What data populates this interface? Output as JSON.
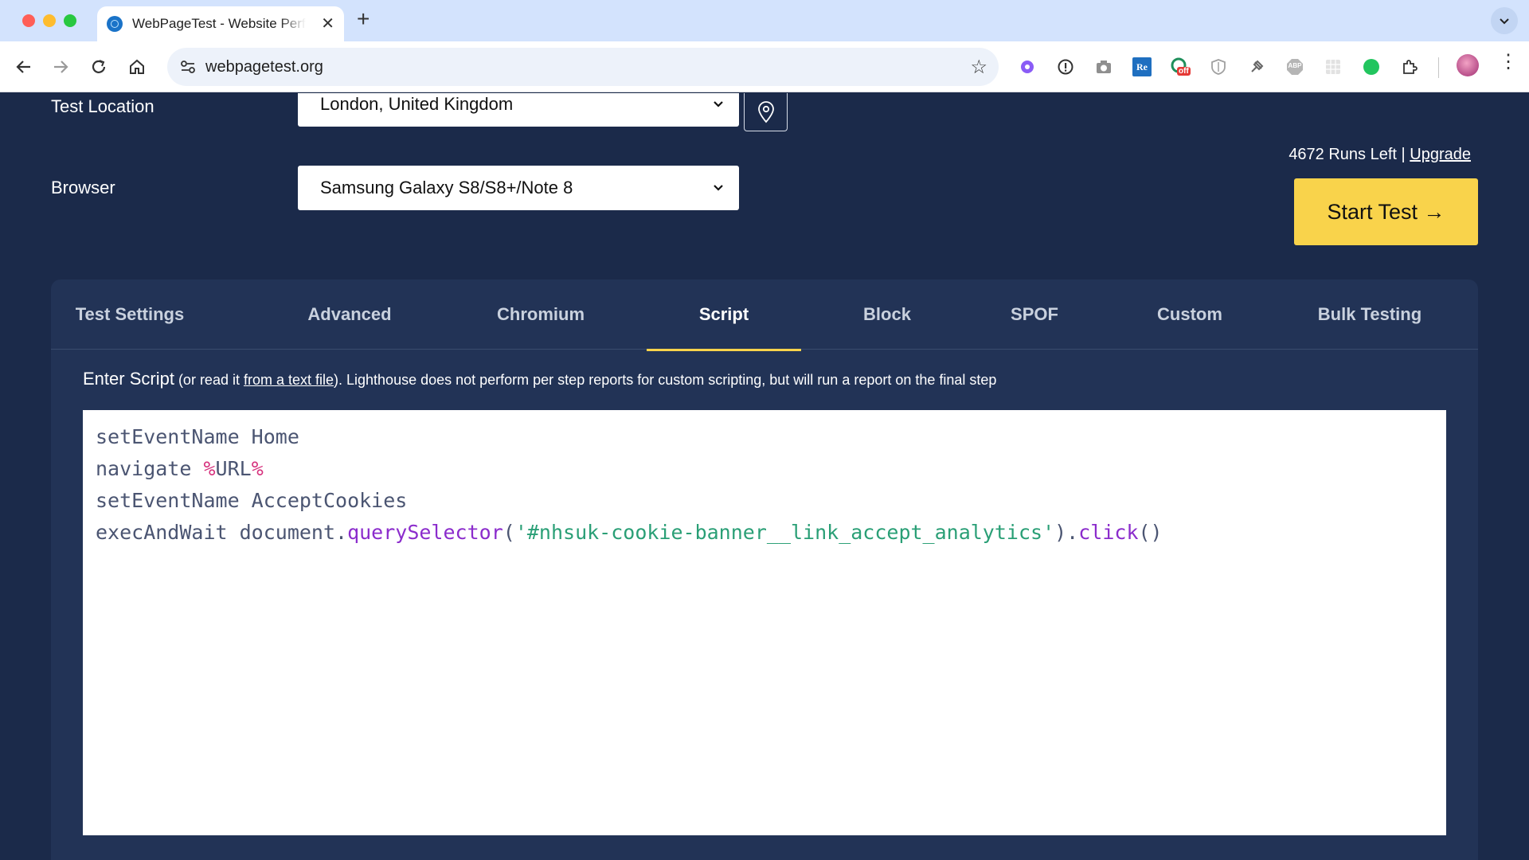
{
  "browser": {
    "tab_title": "WebPageTest - Website Performance",
    "url": "webpagetest.org",
    "extensions": [
      "puzzle-gear-icon",
      "info-icon",
      "camera-icon",
      "re-icon",
      "off-badge-icon",
      "shield-icon",
      "pin-icon",
      "abp-icon",
      "grid-icon",
      "green-dot-icon",
      "extensions-icon"
    ],
    "ext_re_text": "Re",
    "ext_off_text": "off",
    "ext_abp_text": "ABP"
  },
  "form": {
    "test_location_label": "Test Location",
    "test_location_value": "London, United Kingdom",
    "browser_label": "Browser",
    "browser_value": "Samsung Galaxy S8/S8+/Note 8",
    "runs_left": "4672 Runs Left",
    "runs_separator": " | ",
    "upgrade": "Upgrade",
    "start_test": "Start Test →"
  },
  "tabs": [
    "Test Settings",
    "Advanced",
    "Chromium",
    "Script",
    "Block",
    "SPOF",
    "Custom",
    "Bulk Testing"
  ],
  "active_tab": "Script",
  "script": {
    "label_main": "Enter Script",
    "label_pre": " (or read it ",
    "label_link": "from a text file",
    "label_post": "). Lighthouse does not perform per step reports for custom scripting, but will run a report on the final step",
    "lines": {
      "l1": "setEventName Home",
      "l2_cmd": "navigate ",
      "l2_pct1": "%",
      "l2_url": "URL",
      "l2_pct2": "%",
      "l3": "setEventName AcceptCookies",
      "l4_cmd": "execAndWait document.",
      "l4_fn": "querySelector",
      "l4_paren_open": "(",
      "l4_str": "'#nhsuk-cookie-banner__link_accept_analytics'",
      "l4_dot": ").",
      "l4_fn2": "click",
      "l4_end": "()"
    }
  },
  "colors": {
    "page_bg": "#1b2a4a",
    "panel_bg": "#223356",
    "accent_yellow": "#f9d34b"
  }
}
